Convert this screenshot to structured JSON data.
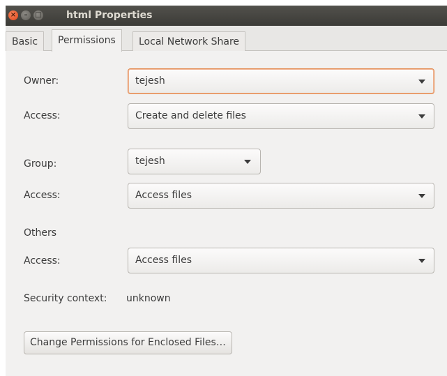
{
  "window": {
    "title": "html Properties",
    "controls": {
      "close": "×",
      "minimize": "–",
      "maximize": "□"
    }
  },
  "tabs": [
    {
      "label": "Basic",
      "active": false
    },
    {
      "label": "Permissions",
      "active": true
    },
    {
      "label": "Local Network Share",
      "active": false
    }
  ],
  "owner": {
    "label": "Owner:",
    "value": "tejesh",
    "access_label": "Access:",
    "access_value": "Create and delete files"
  },
  "group": {
    "label": "Group:",
    "value": "tejesh",
    "access_label": "Access:",
    "access_value": "Access files"
  },
  "others": {
    "label": "Others",
    "access_label": "Access:",
    "access_value": "Access files"
  },
  "security": {
    "label": "Security context:",
    "value": "unknown"
  },
  "enclosed_button": {
    "label": "Change Permissions for Enclosed Files…"
  },
  "colors": {
    "titlebar": "#3c3b37",
    "close": "#e0461a",
    "focus_border": "#e3894d",
    "window_bg": "#f2f1f0"
  }
}
